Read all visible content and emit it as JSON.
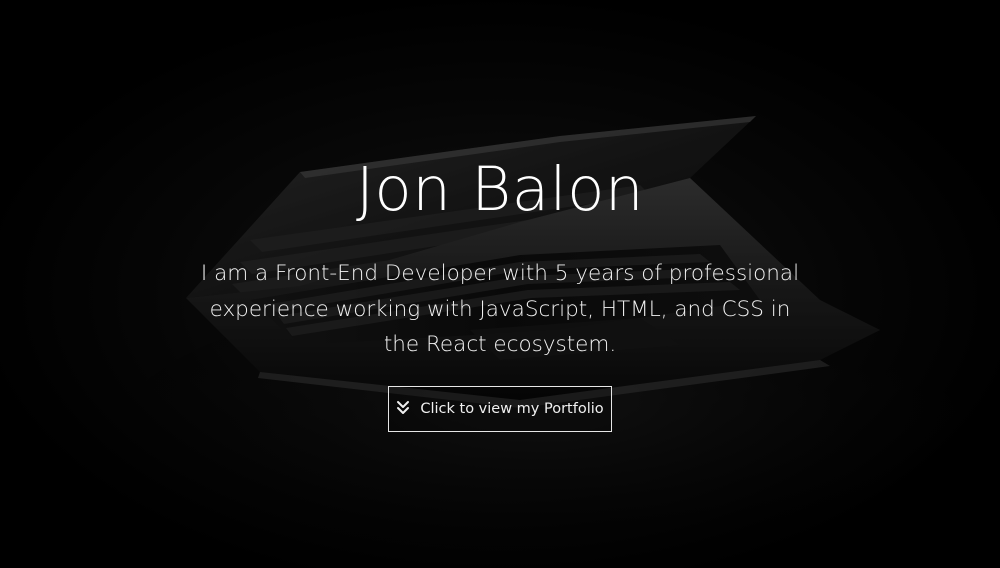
{
  "hero": {
    "title": "Jon Balon",
    "bio": "I am a Front-End Developer with 5 years of professional experience working with JavaScript, HTML, and CSS in the React ecosystem.",
    "cta": {
      "label": "Click to view my Portfolio",
      "icon": "double-chevron-down-icon"
    }
  },
  "colors": {
    "background": "#000000",
    "text": "#ffffff",
    "button_border": "#e6e6e6"
  }
}
